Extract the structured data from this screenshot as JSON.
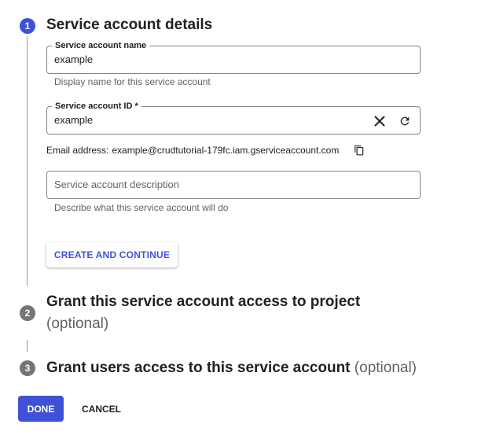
{
  "steps": [
    {
      "number": "1",
      "title": "Service account details",
      "optional": ""
    },
    {
      "number": "2",
      "title": "Grant this service account access to project",
      "optional": "(optional)"
    },
    {
      "number": "3",
      "title": "Grant users access to this service account",
      "optional": "(optional)"
    }
  ],
  "form": {
    "name_field": {
      "label": "Service account name",
      "value": "example",
      "hint": "Display name for this service account"
    },
    "id_field": {
      "label": "Service account ID *",
      "value": "example"
    },
    "email": {
      "label": "Email address:",
      "value": "example@crudtutorial-179fc.iam.gserviceaccount.com"
    },
    "description_field": {
      "placeholder": "Service account description",
      "hint": "Describe what this service account will do"
    }
  },
  "buttons": {
    "create_continue": "CREATE AND CONTINUE",
    "done": "DONE",
    "cancel": "CANCEL"
  },
  "icons": {
    "clear": "close-icon",
    "refresh": "refresh-icon",
    "copy": "copy-icon"
  },
  "colors": {
    "accent": "#3f51d6",
    "inactive_step": "#757575"
  }
}
